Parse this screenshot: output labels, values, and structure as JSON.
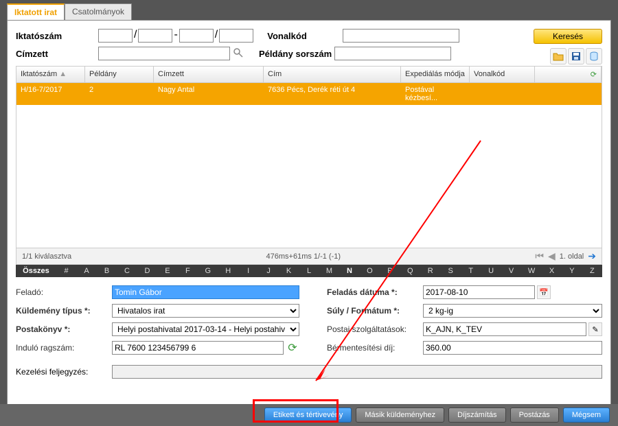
{
  "tabs": {
    "active": "Iktatott irat",
    "other": "Csatolmányok"
  },
  "search": {
    "label_iktatoszam": "Iktatószám",
    "label_cimzett": "Címzett",
    "label_vonalkod": "Vonalkód",
    "label_peldany": "Példány sorszám",
    "btn_search": "Keresés"
  },
  "table": {
    "headers": {
      "c1": "Iktatószám",
      "c2": "Példány",
      "c3": "Címzett",
      "c4": "Cím",
      "c5": "Expediálás módja",
      "c6": "Vonalkód"
    },
    "row": {
      "c1": "H/16-7/2017",
      "c2": "2",
      "c3": "Nagy Antal",
      "c4": "7636 Pécs, Derék réti út 4",
      "c5": "Postával kézbesí...",
      "c6": ""
    },
    "status": "1/1 kiválasztva",
    "timing": "476ms+61ms 1/-1 (-1)",
    "page": "1. oldal"
  },
  "alpha": {
    "first": "Összes",
    "hash": "#",
    "hotN": "N"
  },
  "form": {
    "felado_lbl": "Feladó:",
    "felado": "Tomin Gábor",
    "kuld_tipus_lbl": "Küldemény típus *:",
    "kuld_tipus": "Hivatalos irat",
    "postakonyv_lbl": "Postakönyv *:",
    "postakonyv": "Helyi postahivatal 2017-03-14 - Helyi postahiv",
    "indulo_lbl": "Induló ragszám:",
    "indulo": "RL 7600 123456799 6",
    "feladas_lbl": "Feladás dátuma *:",
    "feladas": "2017-08-10",
    "suly_lbl": "Súly / Formátum *:",
    "suly": "2 kg-ig",
    "postai_lbl": "Postai szolgáltatások:",
    "postai": "K_AJN, K_TEV",
    "bermentes_lbl": "Bérmentesítési díj:",
    "bermentes": "360.00",
    "kezelesi_lbl": "Kezelési feljegyzés:"
  },
  "bottom": {
    "etikett": "Etikett és tértivevény",
    "masik": "Másik küldeményhez",
    "dij": "Díjszámítás",
    "postazas": "Postázás",
    "megsem": "Mégsem"
  }
}
